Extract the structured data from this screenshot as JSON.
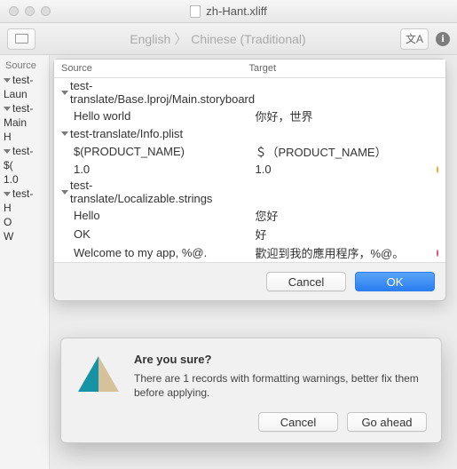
{
  "window": {
    "title": "zh-Hant.xliff"
  },
  "breadcrumb": {
    "from": "English",
    "to": "Chinese (Traditional)"
  },
  "sidebar": {
    "header": "Source",
    "items": [
      {
        "label": "test-",
        "expanded": true
      },
      {
        "label": "Laun",
        "indent": 1
      },
      {
        "label": "test-",
        "expanded": true
      },
      {
        "label": "Main",
        "indent": 1
      },
      {
        "label": "H",
        "indent": 2
      },
      {
        "label": "test-",
        "expanded": true
      },
      {
        "label": "$(",
        "indent": 1
      },
      {
        "label": "1.0",
        "indent": 1
      },
      {
        "label": "test-",
        "expanded": true
      },
      {
        "label": "H",
        "indent": 1
      },
      {
        "label": "O",
        "indent": 1
      },
      {
        "label": "W",
        "indent": 1
      }
    ]
  },
  "table": {
    "headers": {
      "source": "Source",
      "target": "Target"
    },
    "groups": [
      {
        "title": "test-translate/Base.lproj/Main.storyboard",
        "rows": [
          {
            "source": "Hello world",
            "target": "你好，世界"
          }
        ]
      },
      {
        "title": "test-translate/Info.plist",
        "rows": [
          {
            "source": "$(PRODUCT_NAME)",
            "target": "＄（PRODUCT_NAME）"
          },
          {
            "source": "1.0",
            "target": "1.0",
            "dot": "#f5a623"
          }
        ]
      },
      {
        "title": "test-translate/Localizable.strings",
        "rows": [
          {
            "source": "Hello",
            "target": "您好"
          },
          {
            "source": "OK",
            "target": "好"
          },
          {
            "source": "Welcome to my app, %@.",
            "target": "歡迎到我的應用程序，%@。",
            "dot": "#e94b6a"
          }
        ]
      }
    ],
    "buttons": {
      "cancel": "Cancel",
      "ok": "OK"
    }
  },
  "dialog": {
    "title": "Are you sure?",
    "message": "There are 1 records with formatting warnings, better fix them before applying.",
    "cancel": "Cancel",
    "confirm": "Go ahead"
  },
  "colors": {
    "traffic": "#dcdcdc"
  }
}
